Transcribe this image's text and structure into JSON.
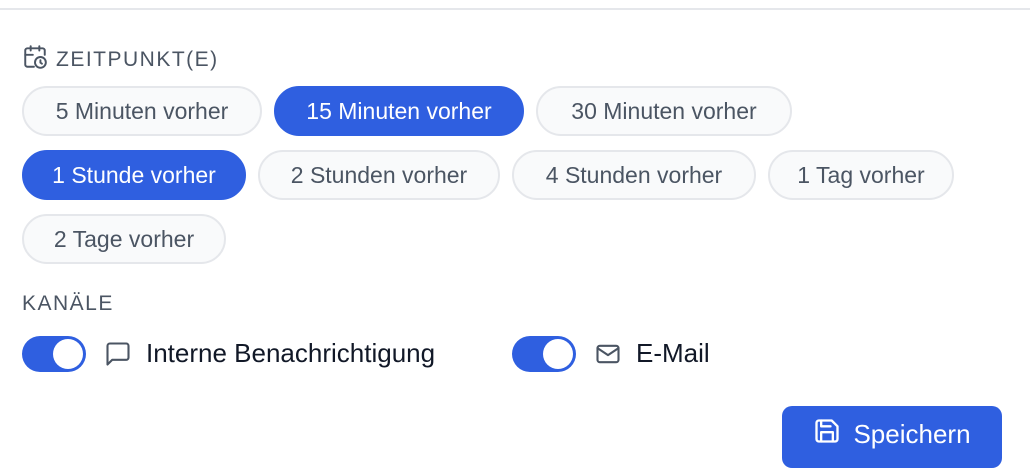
{
  "sections": {
    "zeitpunkte_label": "ZEITPUNKT(E)",
    "kanale_label": "KANÄLE"
  },
  "timing_options": [
    {
      "label": "5 Minuten vorher",
      "selected": false
    },
    {
      "label": "15 Minuten vorher",
      "selected": true
    },
    {
      "label": "30 Minuten vorher",
      "selected": false
    },
    {
      "label": "1 Stunde vorher",
      "selected": true
    },
    {
      "label": "2 Stunden vorher",
      "selected": false
    },
    {
      "label": "4 Stunden vorher",
      "selected": false
    },
    {
      "label": "1 Tag vorher",
      "selected": false
    },
    {
      "label": "2 Tage vorher",
      "selected": false
    }
  ],
  "channels": [
    {
      "label": "Interne Benachrichtigung",
      "enabled": true,
      "icon": "message-icon"
    },
    {
      "label": "E-Mail",
      "enabled": true,
      "icon": "mail-icon"
    }
  ],
  "actions": {
    "save_label": "Speichern"
  },
  "colors": {
    "accent": "#2f5fe0",
    "chip_border": "#e5e7eb",
    "chip_bg": "#f9fafb",
    "muted_text": "#4b5563"
  }
}
